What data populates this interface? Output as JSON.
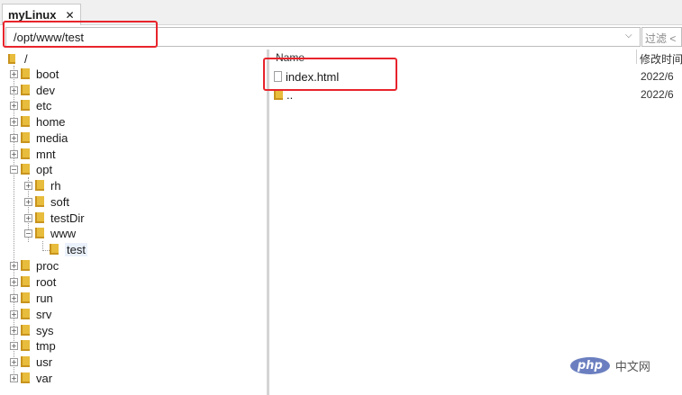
{
  "tab": {
    "title": "myLinux",
    "close": "✕"
  },
  "path": {
    "value": "/opt/www/test",
    "filter_placeholder": "过滤 <"
  },
  "tree": {
    "root": "/",
    "items": [
      "boot",
      "dev",
      "etc",
      "home",
      "media",
      "mnt",
      "opt",
      "rh",
      "soft",
      "testDir",
      "www",
      "test",
      "proc",
      "root",
      "run",
      "srv",
      "sys",
      "tmp",
      "usr",
      "var"
    ]
  },
  "list": {
    "columns": {
      "name": "Name",
      "modified": "修改时间"
    },
    "rows": [
      {
        "name": "index.html",
        "date": "2022/6"
      },
      {
        "name": "..",
        "date": "2022/6"
      }
    ]
  },
  "colors": {
    "highlight": "#e8242c",
    "folder": "#e8bc3c"
  },
  "watermark": {
    "logo": "php",
    "text": "中文网"
  }
}
